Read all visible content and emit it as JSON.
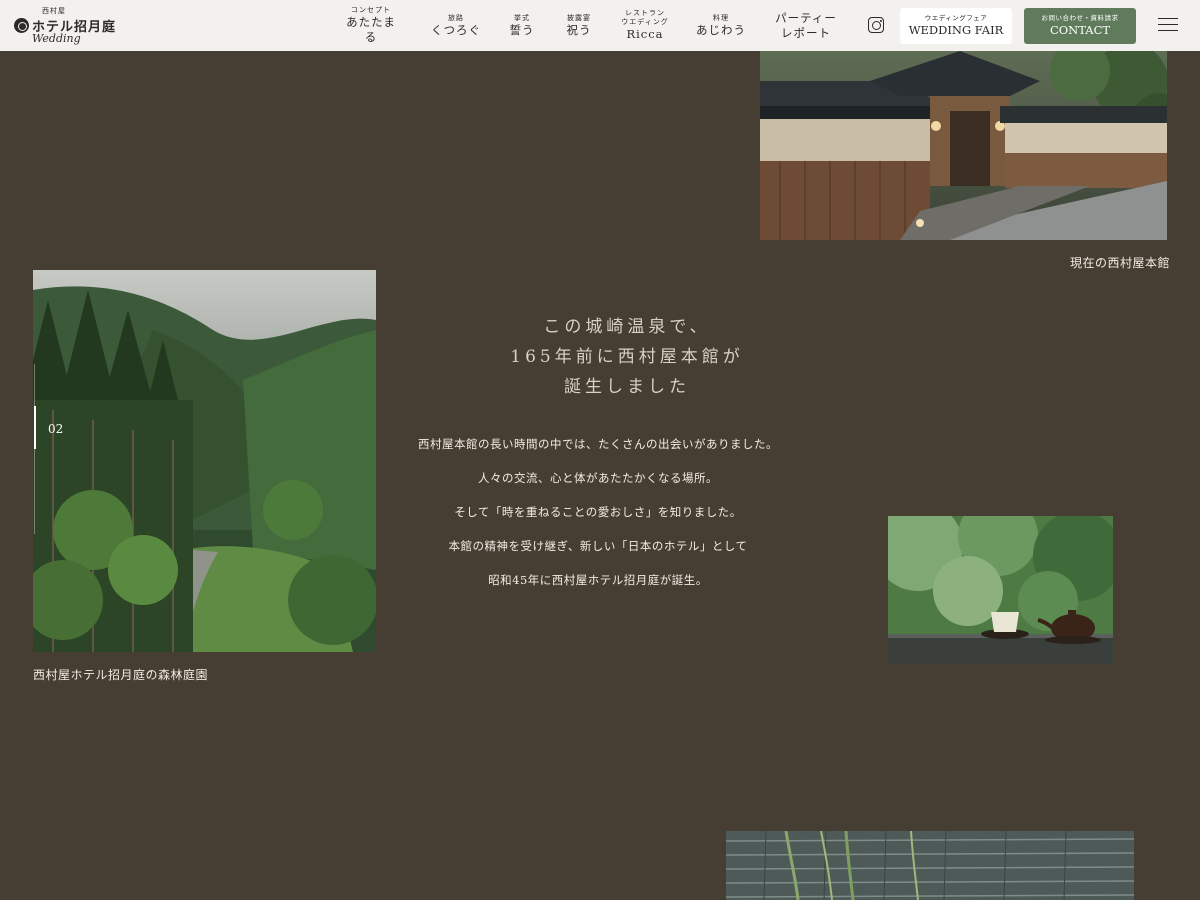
{
  "header": {
    "logo": {
      "small_text": "西村屋",
      "main_text": "ホテル招月庭",
      "script_text": "Wedding"
    },
    "nav": [
      {
        "sub": "コンセプト",
        "label": "あたたまる"
      },
      {
        "sub": "旅路",
        "label": "くつろぐ"
      },
      {
        "sub": "挙式",
        "label": "誓う"
      },
      {
        "sub": "披露宴",
        "label": "祝う"
      },
      {
        "sub": "レストラン\nウエディング",
        "label": "Ricca"
      },
      {
        "sub": "料理",
        "label": "あじわう"
      },
      {
        "sub": "",
        "label": "パーティー\nレポート"
      }
    ],
    "instagram_icon": "instagram-icon",
    "fair_button": {
      "sub": "ウエディングフェア",
      "label": "WEDDING FAIR"
    },
    "contact_button": {
      "sub": "お問い合わせ・資料請求",
      "label": "CONTACT"
    },
    "menu_icon": "hamburger-menu-icon",
    "colors": {
      "header_bg": "#f3f1ed",
      "contact_bg": "#607b5c"
    }
  },
  "main": {
    "background": "#463e32",
    "photo_inn_caption": "現在の西村屋本館",
    "photo_forest_caption": "西村屋ホテル招月庭の森林庭園",
    "slide_index": "02",
    "headline": [
      "この城崎温泉で、",
      "165年前に西村屋本館が",
      "誕生しました"
    ],
    "body": [
      "西村屋本館の長い時間の中では、たくさんの出会いがありました。",
      "人々の交流、心と体があたたかくなる場所。",
      "そして「時を重ねることの愛おしさ」を知りました。",
      "本館の精神を受け継ぎ、新しい「日本のホテル」として",
      "昭和45年に西村屋ホテル招月庭が誕生。"
    ]
  }
}
